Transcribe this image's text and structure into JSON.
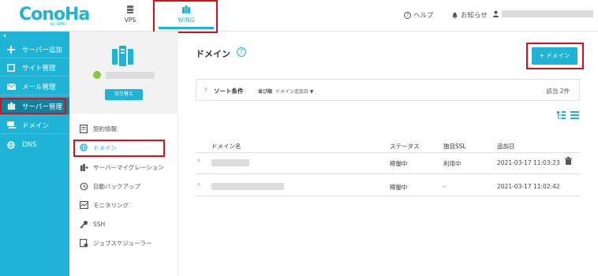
{
  "header": {
    "logo": "ConoHa",
    "logo_sub": "by GMO",
    "tabs": [
      {
        "label": "VPS",
        "icon": "server-icon"
      },
      {
        "label": "WING",
        "icon": "wing-icon",
        "active": true
      }
    ],
    "help_label": "ヘルプ",
    "notice_label": "お知らせ"
  },
  "sidebar": {
    "collapse_glyph": "‹",
    "items": [
      {
        "label": "サーバー追加",
        "icon": "plus-icon"
      },
      {
        "label": "サイト管理",
        "icon": "site-icon"
      },
      {
        "label": "メール管理",
        "icon": "mail-icon"
      },
      {
        "label": "サーバー管理",
        "icon": "server-manage-icon",
        "active": true
      },
      {
        "label": "ドメイン",
        "icon": "domain-icon"
      },
      {
        "label": "DNS",
        "icon": "globe-icon"
      }
    ]
  },
  "server_pane": {
    "switch_label": "切り替え",
    "menu": [
      {
        "label": "契約情報",
        "icon": "contract-icon"
      },
      {
        "label": "ドメイン",
        "icon": "globe-icon",
        "active": true
      },
      {
        "label": "サーバーマイグレーション",
        "icon": "migration-icon"
      },
      {
        "label": "自動バックアップ",
        "icon": "backup-icon"
      },
      {
        "label": "モニタリング",
        "icon": "monitor-icon"
      },
      {
        "label": "SSH",
        "icon": "key-icon"
      },
      {
        "label": "ジョブスケジューラー",
        "icon": "scheduler-icon"
      }
    ]
  },
  "main": {
    "title": "ドメイン",
    "help_glyph": "?",
    "add_button": "+ ドメイン",
    "sort": {
      "label": "ソート条件",
      "order_label": "並び順",
      "order_value": "ドメイン追加日 ▼",
      "count": "該当 2件"
    },
    "table": {
      "columns": [
        "ドメイン名",
        "ステータス",
        "独自SSL",
        "追加日"
      ],
      "rows": [
        {
          "status": "稼働中",
          "ssl": "利用中",
          "date": "2021-03-17 11:03:23"
        },
        {
          "status": "稼働中",
          "ssl": "-",
          "date": "2021-03-17 11:02:42"
        }
      ]
    }
  },
  "colors": {
    "brand": "#1fb3d6",
    "sidebar_active": "#11819d",
    "highlight": "#d9101a",
    "status_green": "#8cc63f"
  }
}
